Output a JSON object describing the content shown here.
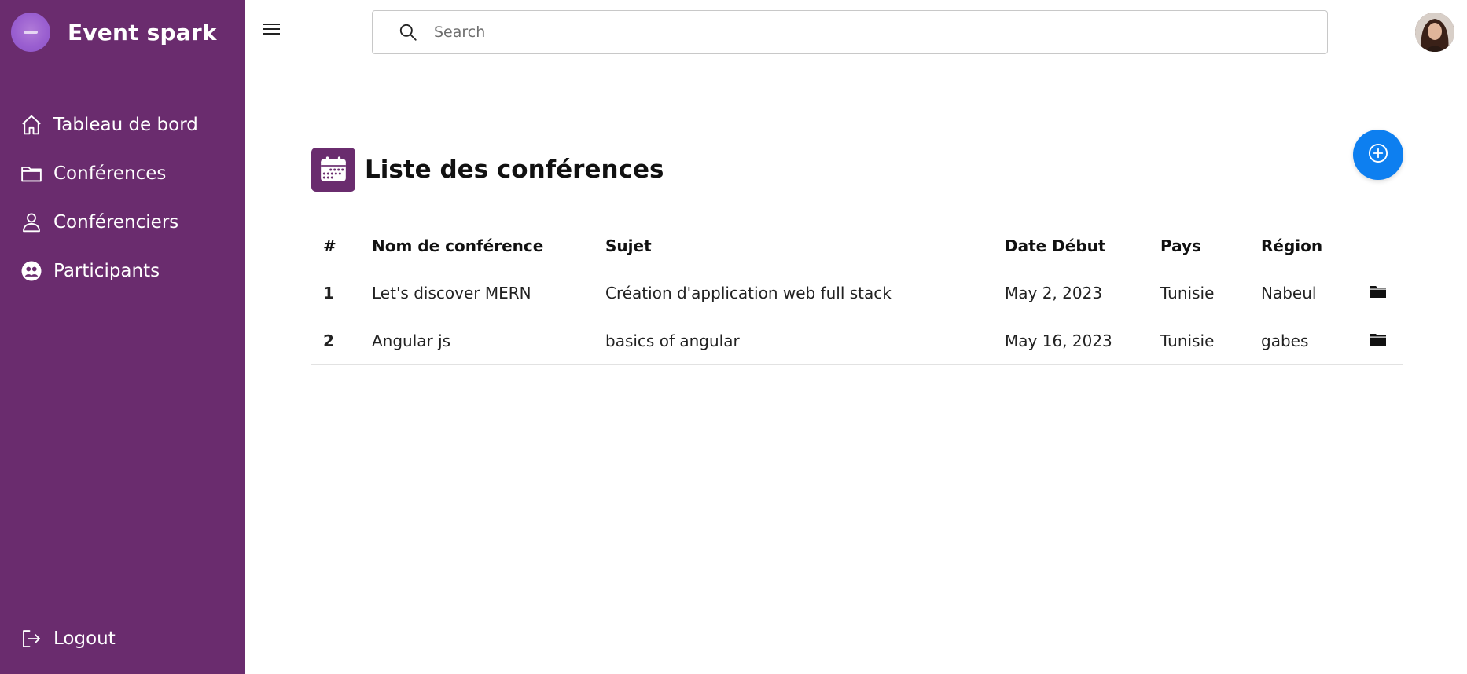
{
  "brand": {
    "name": "Event spark"
  },
  "sidebar": {
    "items": [
      {
        "label": "Tableau de bord",
        "icon": "home-icon"
      },
      {
        "label": "Conférences",
        "icon": "folder-icon"
      },
      {
        "label": "Conférenciers",
        "icon": "user-icon"
      },
      {
        "label": "Participants",
        "icon": "users-icon"
      }
    ],
    "logout_label": "Logout"
  },
  "search": {
    "placeholder": "Search",
    "value": ""
  },
  "page": {
    "title": "Liste des conférences"
  },
  "table": {
    "headers": [
      "#",
      "Nom de conférence",
      "Sujet",
      "Date Début",
      "Pays",
      "Région"
    ],
    "rows": [
      {
        "id": "1",
        "name": "Let's discover MERN",
        "subject": "Création d'application web full stack",
        "date": "May 2, 2023",
        "country": "Tunisie",
        "region": "Nabeul"
      },
      {
        "id": "2",
        "name": "Angular js",
        "subject": "basics of angular",
        "date": "May 16, 2023",
        "country": "Tunisie",
        "region": "gabes"
      }
    ]
  },
  "colors": {
    "sidebar": "#6a2c6e",
    "accent": "#0d7ff0",
    "page_icon": "#6a2c6e"
  }
}
